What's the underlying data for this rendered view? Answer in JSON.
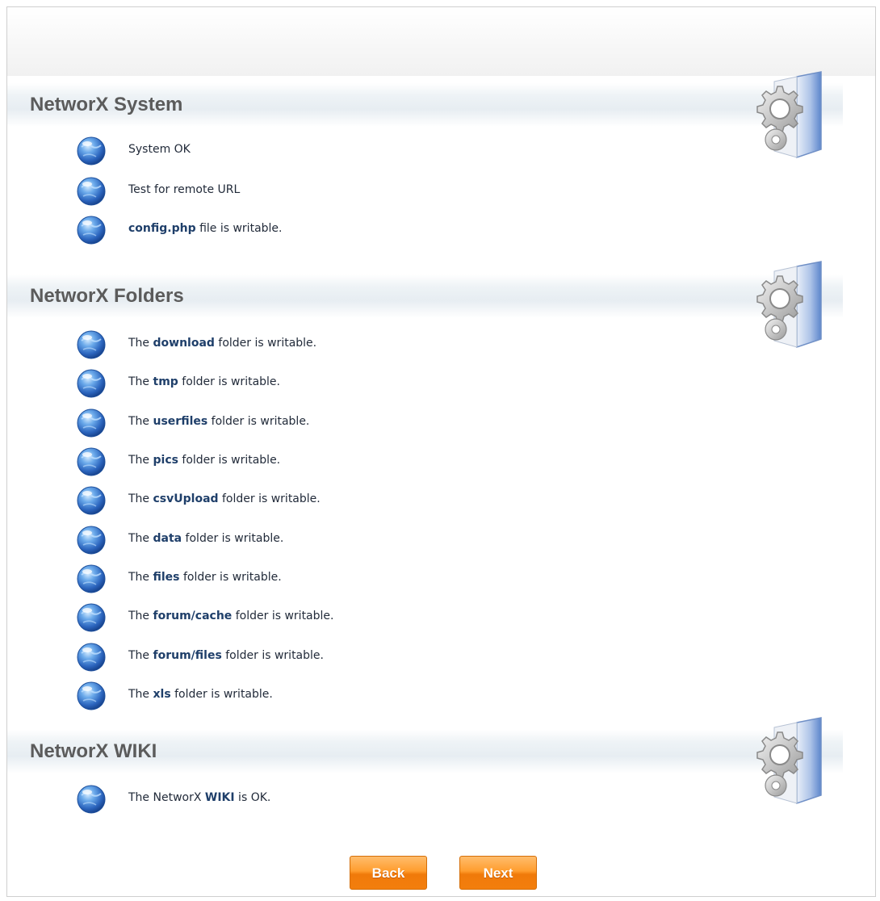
{
  "sections": [
    {
      "title": "NetworX System",
      "items": [
        {
          "pre": "System OK",
          "bold": "",
          "post": ""
        },
        {
          "pre": "Test for remote URL",
          "bold": "",
          "post": ""
        },
        {
          "pre": "",
          "bold": "config.php",
          "post": " file is writable."
        }
      ]
    },
    {
      "title": "NetworX Folders",
      "items": [
        {
          "pre": "The ",
          "bold": "download",
          "post": " folder is writable."
        },
        {
          "pre": "The ",
          "bold": "tmp",
          "post": " folder is writable."
        },
        {
          "pre": "The ",
          "bold": "userfiles",
          "post": " folder is writable."
        },
        {
          "pre": "The ",
          "bold": "pics",
          "post": " folder is writable."
        },
        {
          "pre": "The ",
          "bold": "csvUpload",
          "post": " folder is writable."
        },
        {
          "pre": "The ",
          "bold": "data",
          "post": " folder is writable."
        },
        {
          "pre": "The ",
          "bold": "files",
          "post": " folder is writable."
        },
        {
          "pre": "The ",
          "bold": "forum/cache",
          "post": " folder is writable."
        },
        {
          "pre": "The ",
          "bold": "forum/files",
          "post": " folder is writable."
        },
        {
          "pre": "The ",
          "bold": "xls",
          "post": " folder is writable."
        }
      ]
    },
    {
      "title": "NetworX WIKI",
      "items": [
        {
          "pre": "The NetworX ",
          "bold": "WIKI",
          "post": " is OK."
        }
      ]
    }
  ],
  "buttons": {
    "back": "Back",
    "next": "Next"
  },
  "icons": {
    "status": "globe-icon",
    "section": "gear-folder-icon"
  },
  "colors": {
    "button": "#ff9d2e",
    "title": "#5b5b5b",
    "bold_text": "#1f3f6a"
  }
}
